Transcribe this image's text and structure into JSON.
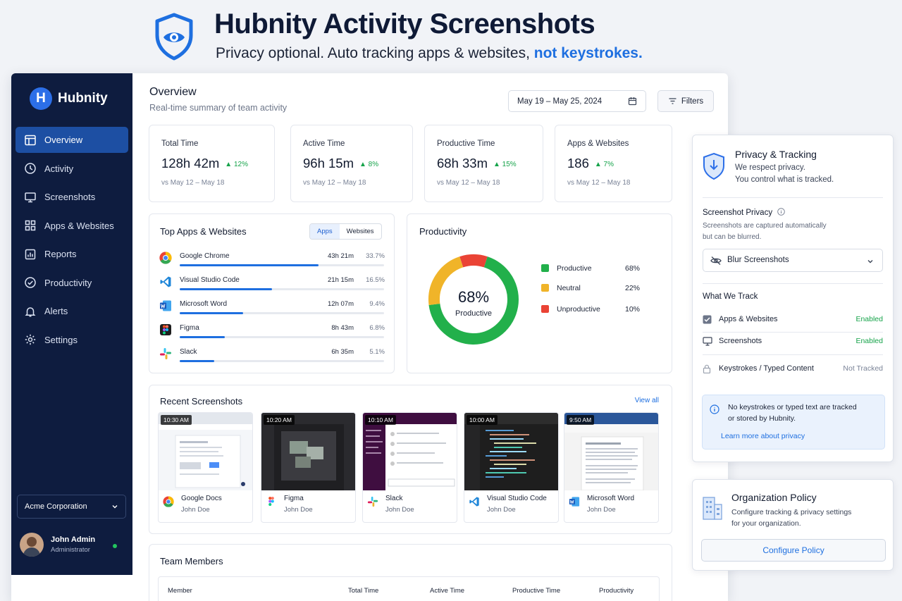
{
  "hero": {
    "title": "Hubnity Activity Screenshots",
    "subtitle_prefix": "Privacy optional. Auto tracking apps & websites,",
    "subtitle_highlight": "not keystrokes."
  },
  "sidebar": {
    "logo_letter": "H",
    "brand": "Hubnity",
    "items": [
      {
        "label": "Overview",
        "icon": "dashboard-icon",
        "active": true
      },
      {
        "label": "Activity",
        "icon": "clock-icon"
      },
      {
        "label": "Screenshots",
        "icon": "monitor-icon"
      },
      {
        "label": "Apps & Websites",
        "icon": "grid-icon"
      },
      {
        "label": "Reports",
        "icon": "chart-icon"
      },
      {
        "label": "Productivity",
        "icon": "check-circle-icon"
      },
      {
        "label": "Alerts",
        "icon": "bell-icon"
      },
      {
        "label": "Settings",
        "icon": "gear-icon"
      }
    ],
    "org": "Acme Corporation",
    "user": {
      "name": "John Admin",
      "role": "Administrator"
    }
  },
  "header": {
    "title": "Overview",
    "subtitle": "Real-time summary of team activity",
    "date_range": "May 19 – May 25, 2024",
    "filters_label": "Filters"
  },
  "stats": [
    {
      "label": "Total Time",
      "value": "128h 42m",
      "delta": "▲ 12%",
      "compare": "vs May 12 – May 18"
    },
    {
      "label": "Active Time",
      "value": "96h 15m",
      "delta": "▲ 8%",
      "compare": "vs May 12 – May 18"
    },
    {
      "label": "Productive Time",
      "value": "68h 33m",
      "delta": "▲ 15%",
      "compare": "vs May 12 – May 18"
    },
    {
      "label": "Apps & Websites",
      "value": "186",
      "delta": "▲ 7%",
      "compare": "vs May 12 – May 18"
    }
  ],
  "top_apps": {
    "title": "Top Apps & Websites",
    "tabs": [
      "Apps",
      "Websites"
    ],
    "items": [
      {
        "name": "Google Chrome",
        "time": "43h 21m",
        "pct": "33.7%",
        "share": 0.68
      },
      {
        "name": "Visual Studio Code",
        "time": "21h 15m",
        "pct": "16.5%",
        "share": 0.45
      },
      {
        "name": "Microsoft Word",
        "time": "12h 07m",
        "pct": "9.4%",
        "share": 0.31
      },
      {
        "name": "Figma",
        "time": "8h 43m",
        "pct": "6.8%",
        "share": 0.22
      },
      {
        "name": "Slack",
        "time": "6h 35m",
        "pct": "5.1%",
        "share": 0.17
      }
    ]
  },
  "productivity": {
    "title": "Productivity",
    "center_value": "68%",
    "center_label": "Productive",
    "segments": [
      {
        "label": "Productive",
        "pct": "68%",
        "value": 68,
        "color": "#22b04b"
      },
      {
        "label": "Neutral",
        "pct": "22%",
        "value": 22,
        "color": "#f0b429"
      },
      {
        "label": "Unproductive",
        "pct": "10%",
        "value": 10,
        "color": "#ea4335"
      }
    ]
  },
  "screenshots": {
    "title": "Recent Screenshots",
    "view_all": "View all",
    "items": [
      {
        "time": "10:30 AM",
        "app": "Google Docs",
        "user": "John Doe"
      },
      {
        "time": "10:20 AM",
        "app": "Figma",
        "user": "John Doe"
      },
      {
        "time": "10:10 AM",
        "app": "Slack",
        "user": "John Doe"
      },
      {
        "time": "10:00 AM",
        "app": "Visual Studio Code",
        "user": "John Doe"
      },
      {
        "time": "9:50 AM",
        "app": "Microsoft Word",
        "user": "John Doe"
      }
    ]
  },
  "team": {
    "title": "Team Members",
    "columns": [
      "Member",
      "Total Time",
      "Active Time",
      "Productive Time",
      "Productivity"
    ]
  },
  "privacy": {
    "title": "Privacy & Tracking",
    "sub1": "We respect privacy.",
    "sub2": "You control what is tracked.",
    "screenshot_privacy_title": "Screenshot Privacy",
    "screenshot_privacy_desc1": "Screenshots are captured automatically",
    "screenshot_privacy_desc2": "but can be blurred.",
    "blur_select": "Blur Screenshots",
    "what_we_track": "What We Track",
    "track_items": [
      {
        "label": "Apps & Websites",
        "status": "Enabled"
      },
      {
        "label": "Screenshots",
        "status": "Enabled"
      },
      {
        "label": "Keystrokes / Typed Content",
        "status": "Not Tracked"
      }
    ],
    "info_line1": "No keystrokes or typed text are tracked",
    "info_line2": "or stored by Hubnity.",
    "info_link": "Learn more about privacy"
  },
  "org_policy": {
    "title": "Organization Policy",
    "desc1": "Configure tracking & privacy settings",
    "desc2": "for your organization.",
    "button": "Configure Policy"
  },
  "colors": {
    "accent": "#1e6fe0",
    "sidebar": "#0e1c3f",
    "success": "#16a34a"
  }
}
